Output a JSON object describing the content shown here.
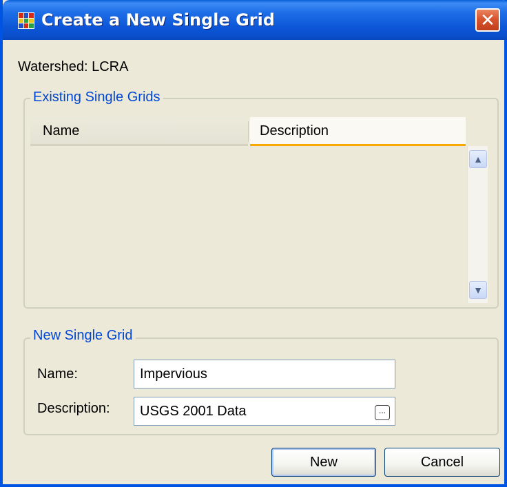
{
  "window": {
    "title": "Create a New Single Grid",
    "close_label": "✕"
  },
  "watershed_label": "Watershed: LCRA",
  "existing_group": {
    "legend": "Existing Single Grids",
    "columns": [
      "Name",
      "Description"
    ],
    "rows": []
  },
  "new_group": {
    "legend": "New Single Grid",
    "name_label": "Name:",
    "name_value": "Impervious",
    "description_label": "Description:",
    "description_value": "USGS 2001 Data",
    "browse_label": "..."
  },
  "buttons": {
    "new_label": "New",
    "cancel_label": "Cancel"
  }
}
